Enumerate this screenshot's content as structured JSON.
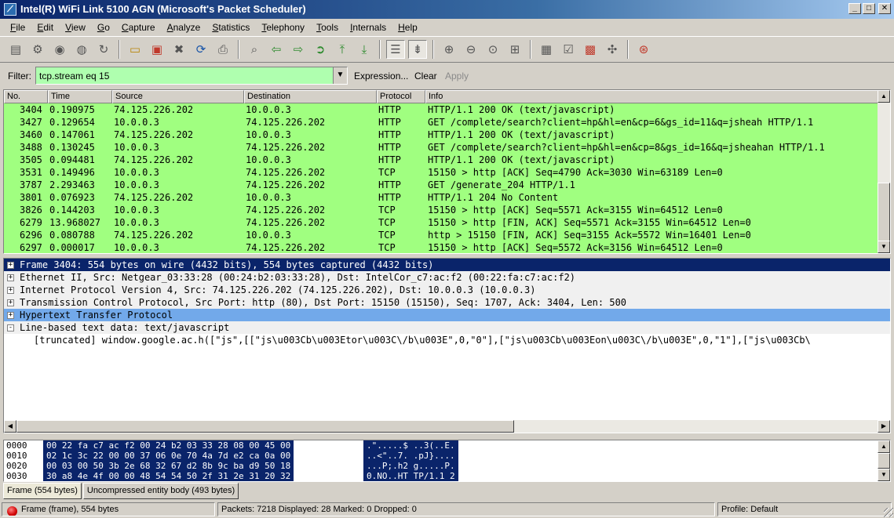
{
  "window": {
    "title": "Intel(R) WiFi Link 5100 AGN (Microsoft's Packet Scheduler)"
  },
  "menu": [
    "File",
    "Edit",
    "View",
    "Go",
    "Capture",
    "Analyze",
    "Statistics",
    "Telephony",
    "Tools",
    "Internals",
    "Help"
  ],
  "filter": {
    "label": "Filter:",
    "value": "tcp.stream eq 15",
    "expression": "Expression...",
    "clear": "Clear",
    "apply": "Apply",
    "background_color": "#afffaf"
  },
  "packet_list": {
    "columns": [
      "No.",
      "Time",
      "Source",
      "Destination",
      "Protocol",
      "Info"
    ],
    "row_color": "#a0ff80",
    "rows": [
      [
        "3404",
        "0.190975",
        "74.125.226.202",
        "10.0.0.3",
        "HTTP",
        "HTTP/1.1 200 OK  (text/javascript)"
      ],
      [
        "3427",
        "0.129654",
        "10.0.0.3",
        "74.125.226.202",
        "HTTP",
        "GET /complete/search?client=hp&hl=en&cp=6&gs_id=11&q=jsheah HTTP/1.1"
      ],
      [
        "3460",
        "0.147061",
        "74.125.226.202",
        "10.0.0.3",
        "HTTP",
        "HTTP/1.1 200 OK  (text/javascript)"
      ],
      [
        "3488",
        "0.130245",
        "10.0.0.3",
        "74.125.226.202",
        "HTTP",
        "GET /complete/search?client=hp&hl=en&cp=8&gs_id=16&q=jsheahan HTTP/1.1"
      ],
      [
        "3505",
        "0.094481",
        "74.125.226.202",
        "10.0.0.3",
        "HTTP",
        "HTTP/1.1 200 OK  (text/javascript)"
      ],
      [
        "3531",
        "0.149496",
        "10.0.0.3",
        "74.125.226.202",
        "TCP",
        "15150 > http [ACK] Seq=4790 Ack=3030 Win=63189 Len=0"
      ],
      [
        "3787",
        "2.293463",
        "10.0.0.3",
        "74.125.226.202",
        "HTTP",
        "GET /generate_204 HTTP/1.1"
      ],
      [
        "3801",
        "0.076923",
        "74.125.226.202",
        "10.0.0.3",
        "HTTP",
        "HTTP/1.1 204 No Content"
      ],
      [
        "3826",
        "0.144203",
        "10.0.0.3",
        "74.125.226.202",
        "TCP",
        "15150 > http [ACK] Seq=5571 Ack=3155 Win=64512 Len=0"
      ],
      [
        "6279",
        "13.968027",
        "10.0.0.3",
        "74.125.226.202",
        "TCP",
        "15150 > http [FIN, ACK] Seq=5571 Ack=3155 Win=64512 Len=0"
      ],
      [
        "6296",
        "0.080788",
        "74.125.226.202",
        "10.0.0.3",
        "TCP",
        "http > 15150 [FIN, ACK] Seq=3155 Ack=5572 Win=16401 Len=0"
      ],
      [
        "6297",
        "0.000017",
        "10.0.0.3",
        "74.125.226.202",
        "TCP",
        "15150 > http [ACK] Seq=5572 Ack=3156 Win=64512 Len=0"
      ]
    ]
  },
  "details": [
    {
      "toggle": "+",
      "text": "Frame 3404: 554 bytes on wire (4432 bits), 554 bytes captured (4432 bits)",
      "style": "sel"
    },
    {
      "toggle": "+",
      "text": "Ethernet II, Src: Netgear_03:33:28 (00:24:b2:03:33:28), Dst: IntelCor_c7:ac:f2 (00:22:fa:c7:ac:f2)",
      "style": "bg"
    },
    {
      "toggle": "+",
      "text": "Internet Protocol Version 4, Src: 74.125.226.202 (74.125.226.202), Dst: 10.0.0.3 (10.0.0.3)",
      "style": "bg"
    },
    {
      "toggle": "+",
      "text": "Transmission Control Protocol, Src Port: http (80), Dst Port: 15150 (15150), Seq: 1707, Ack: 3404, Len: 500",
      "style": "bg"
    },
    {
      "toggle": "+",
      "text": "Hypertext Transfer Protocol",
      "style": "http"
    },
    {
      "toggle": "-",
      "text": "Line-based text data: text/javascript",
      "style": "bg"
    },
    {
      "toggle": "",
      "text": "[truncated] window.google.ac.h([\"js\",[[\"js\\u003Cb\\u003Etor\\u003C\\/b\\u003E\",0,\"0\"],[\"js\\u003Cb\\u003Eon\\u003C\\/b\\u003E\",0,\"1\"],[\"js\\u003Cb\\",
      "style": "child"
    }
  ],
  "bytes": [
    {
      "offset": "0000",
      "hex": "00 22 fa c7 ac f2 00 24  b2 03 33 28 08 00 45 00",
      "ascii": ".\".....$ ..3(..E."
    },
    {
      "offset": "0010",
      "hex": "02 1c 3c 22 00 00 37 06  0e 70 4a 7d e2 ca 0a 00",
      "ascii": "..<\"..7. .pJ}...."
    },
    {
      "offset": "0020",
      "hex": "00 03 00 50 3b 2e 68 32  67 d2 8b 9c ba d9 50 18",
      "ascii": "...P;.h2 g.....P."
    },
    {
      "offset": "0030",
      "hex": "30 a8 4e 4f 00 00 48 54  54 50 2f 31 2e 31 20 32",
      "ascii": "0.NO..HT TP/1.1 2"
    }
  ],
  "byte_tabs": [
    "Frame (554 bytes)",
    "Uncompressed entity body (493 bytes)"
  ],
  "status": {
    "frame": "Frame (frame), 554 bytes",
    "packets": "Packets: 7218 Displayed: 28 Marked: 0 Dropped: 0",
    "profile": "Profile: Default"
  },
  "icons": {
    "toolbar": [
      "interface-list-icon",
      "capture-options-icon",
      "start-capture-icon",
      "stop-capture-icon",
      "restart-capture-icon",
      "open-file-icon",
      "save-file-icon",
      "close-file-icon",
      "reload-icon",
      "print-icon",
      "find-packet-icon",
      "go-back-icon",
      "go-forward-icon",
      "go-to-packet-icon",
      "go-first-icon",
      "go-last-icon",
      "colorize-icon",
      "auto-scroll-icon",
      "zoom-in-icon",
      "zoom-out-icon",
      "zoom-normal-icon",
      "resize-columns-icon",
      "capture-filters-icon",
      "display-filters-icon",
      "coloring-rules-icon",
      "preferences-icon",
      "help-icon"
    ]
  }
}
